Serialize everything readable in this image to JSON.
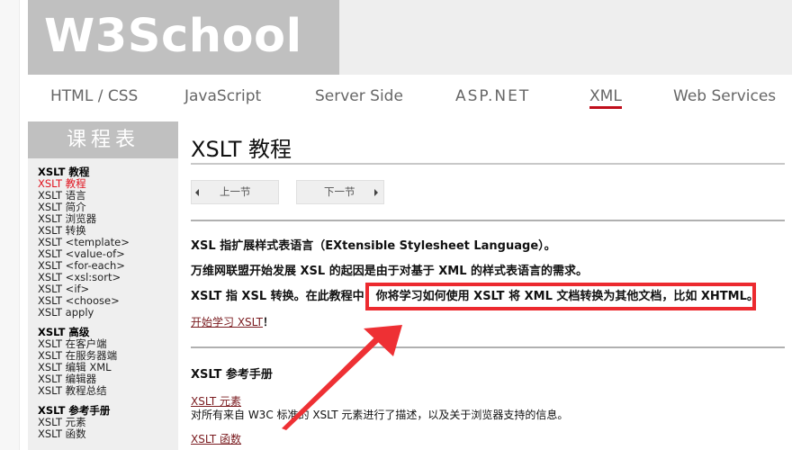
{
  "header": {
    "logo": "W3School"
  },
  "topnav": {
    "items": [
      {
        "label": "HTML / CSS",
        "active": false
      },
      {
        "label": "JavaScript",
        "active": false
      },
      {
        "label": "Server Side",
        "active": false
      },
      {
        "label": "ASP.NET",
        "active": false
      },
      {
        "label": "XML",
        "active": true
      },
      {
        "label": "Web Services",
        "active": false
      }
    ],
    "accent_color": "#c00e1b"
  },
  "sidebar": {
    "heading": "课程表",
    "groups": [
      {
        "title": "XSLT 教程",
        "items": [
          {
            "label": "XSLT 教程",
            "current": true
          },
          {
            "label": "XSLT 语言"
          },
          {
            "label": "XSLT 简介"
          },
          {
            "label": "XSLT 浏览器"
          },
          {
            "label": "XSLT 转换"
          },
          {
            "label": "XSLT <template>"
          },
          {
            "label": "XSLT <value-of>"
          },
          {
            "label": "XSLT <for-each>"
          },
          {
            "label": "XSLT <xsl:sort>"
          },
          {
            "label": "XSLT <if>"
          },
          {
            "label": "XSLT <choose>"
          },
          {
            "label": "XSLT apply"
          }
        ]
      },
      {
        "title": "XSLT 高级",
        "items": [
          {
            "label": "XSLT 在客户端"
          },
          {
            "label": "XSLT 在服务器端"
          },
          {
            "label": "XSLT 编辑 XML"
          },
          {
            "label": "XSLT 编辑器"
          },
          {
            "label": "XSLT 教程总结"
          }
        ]
      },
      {
        "title": "XSLT 参考手册",
        "items": [
          {
            "label": "XSLT 元素"
          },
          {
            "label": "XSLT 函数"
          }
        ]
      }
    ]
  },
  "main": {
    "title": "XSLT 教程",
    "prev_label": "上一节",
    "next_label": "下一节",
    "intro": {
      "line1": "XSL 指扩展样式表语言（EXtensible Stylesheet Language）。",
      "line2": "万维网联盟开始发展 XSL 的起因是由于对基于 XML 的样式表语言的需求。",
      "line3_prefix": "XSLT 指 XSL 转换。在此教程中，",
      "line3_highlight": "你将学习如何使用 XSLT 将 XML 文档转换为其他文档，比如 XHTML。",
      "start_link": "开始学习 XSLT",
      "start_suffix": "！"
    },
    "reference": {
      "title": "XSLT 参考手册",
      "elements_link": "XSLT 元素",
      "elements_desc": "对所有来自 W3C 标准的 XSLT 元素进行了描述，以及关于浏览器支持的信息。",
      "functions_link": "XSLT 函数"
    }
  },
  "annotation": {
    "highlight_color": "#ec2a2f"
  }
}
